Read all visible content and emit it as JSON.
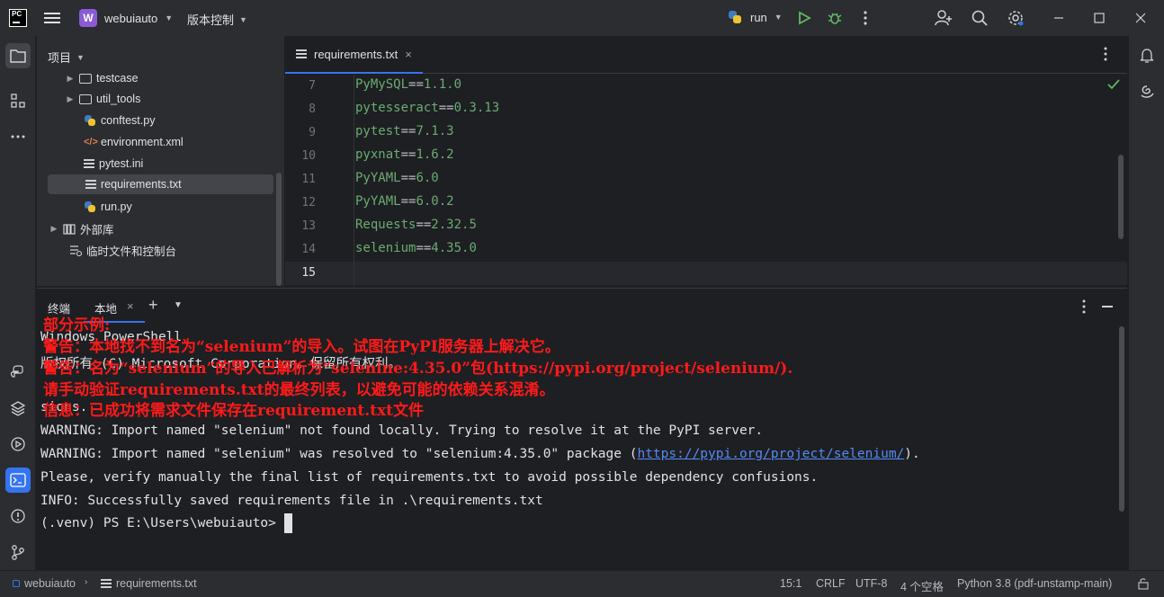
{
  "titlebar": {
    "logo_text": "PC",
    "project_badge": "W",
    "project_name": "webuiauto",
    "vcs_label": "版本控制",
    "run_config": "run"
  },
  "project_pane": {
    "header": "项目",
    "items": [
      {
        "label": "testcase",
        "type": "folder",
        "expandable": true
      },
      {
        "label": "util_tools",
        "type": "folder",
        "expandable": true
      },
      {
        "label": "conftest.py",
        "type": "python"
      },
      {
        "label": "environment.xml",
        "type": "xml"
      },
      {
        "label": "pytest.ini",
        "type": "text"
      },
      {
        "label": "requirements.txt",
        "type": "text",
        "selected": true
      },
      {
        "label": "run.py",
        "type": "python"
      },
      {
        "label": "外部库",
        "type": "library",
        "expandable": true
      },
      {
        "label": "临时文件和控制台",
        "type": "scratch"
      }
    ]
  },
  "editor": {
    "tab_label": "requirements.txt",
    "lines": [
      {
        "num": "7",
        "pkg": "PyMySQL",
        "op": "==",
        "ver": "1.1.0"
      },
      {
        "num": "8",
        "pkg": "pytesseract",
        "op": "==",
        "ver": "0.3.13"
      },
      {
        "num": "9",
        "pkg": "pytest",
        "op": "==",
        "ver": "7.1.3"
      },
      {
        "num": "10",
        "pkg": "pyxnat",
        "op": "==",
        "ver": "1.6.2"
      },
      {
        "num": "11",
        "pkg": "PyYAML",
        "op": "==",
        "ver": "6.0"
      },
      {
        "num": "12",
        "pkg": "PyYAML",
        "op": "==",
        "ver": "6.0.2"
      },
      {
        "num": "13",
        "pkg": "Requests",
        "op": "==",
        "ver": "2.32.5"
      },
      {
        "num": "14",
        "pkg": "selenium",
        "op": "==",
        "ver": "4.35.0"
      },
      {
        "num": "15",
        "pkg": "",
        "op": "",
        "ver": ""
      }
    ]
  },
  "terminal": {
    "tab_terminal": "终端",
    "tab_local": "本地",
    "lines": [
      "Windows PowerShell",
      "版权所有 (C) Microsoft Corporation。保留所有权利。",
      "",
      "",
      "sions.",
      "WARNING: Import named \"selenium\" not found locally. Trying to resolve it at the PyPI server.",
      "",
      "Please, verify manually the final list of requirements.txt to avoid possible dependency confusions.",
      "INFO: Successfully saved requirements file in .\\requirements.txt",
      "(.venv) PS E:\\Users\\webuiauto> "
    ],
    "resolved_prefix": "WARNING: Import named \"selenium\" was resolved to \"selenium:4.35.0\" package (",
    "resolved_link": "https://pypi.org/project/selenium/",
    "resolved_suffix": ").",
    "overlay": [
      "部分示例:",
      "警告：本地找不到名为“selenium”的导入。试图在PyPI服务器上解决它。",
      "警告：名为“selenium”的导入已解析为“selenine:4.35.0”包(https://pypi.org/project/selenium/).",
      "请手动验证requirements.txt的最终列表，以避免可能的依赖关系混淆。",
      "信息：已成功将需求文件保存在requirement.txt文件"
    ]
  },
  "statusbar": {
    "project": "webuiauto",
    "file": "requirements.txt",
    "position": "15:1",
    "line_sep": "CRLF",
    "encoding": "UTF-8",
    "indent": "4 个空格",
    "interpreter": "Python 3.8 (pdf-unstamp-main)"
  },
  "colors": {
    "accent": "#3574f0",
    "overlay_red": "#ff1a1a",
    "package": "#6aab73",
    "link": "#548af7"
  }
}
